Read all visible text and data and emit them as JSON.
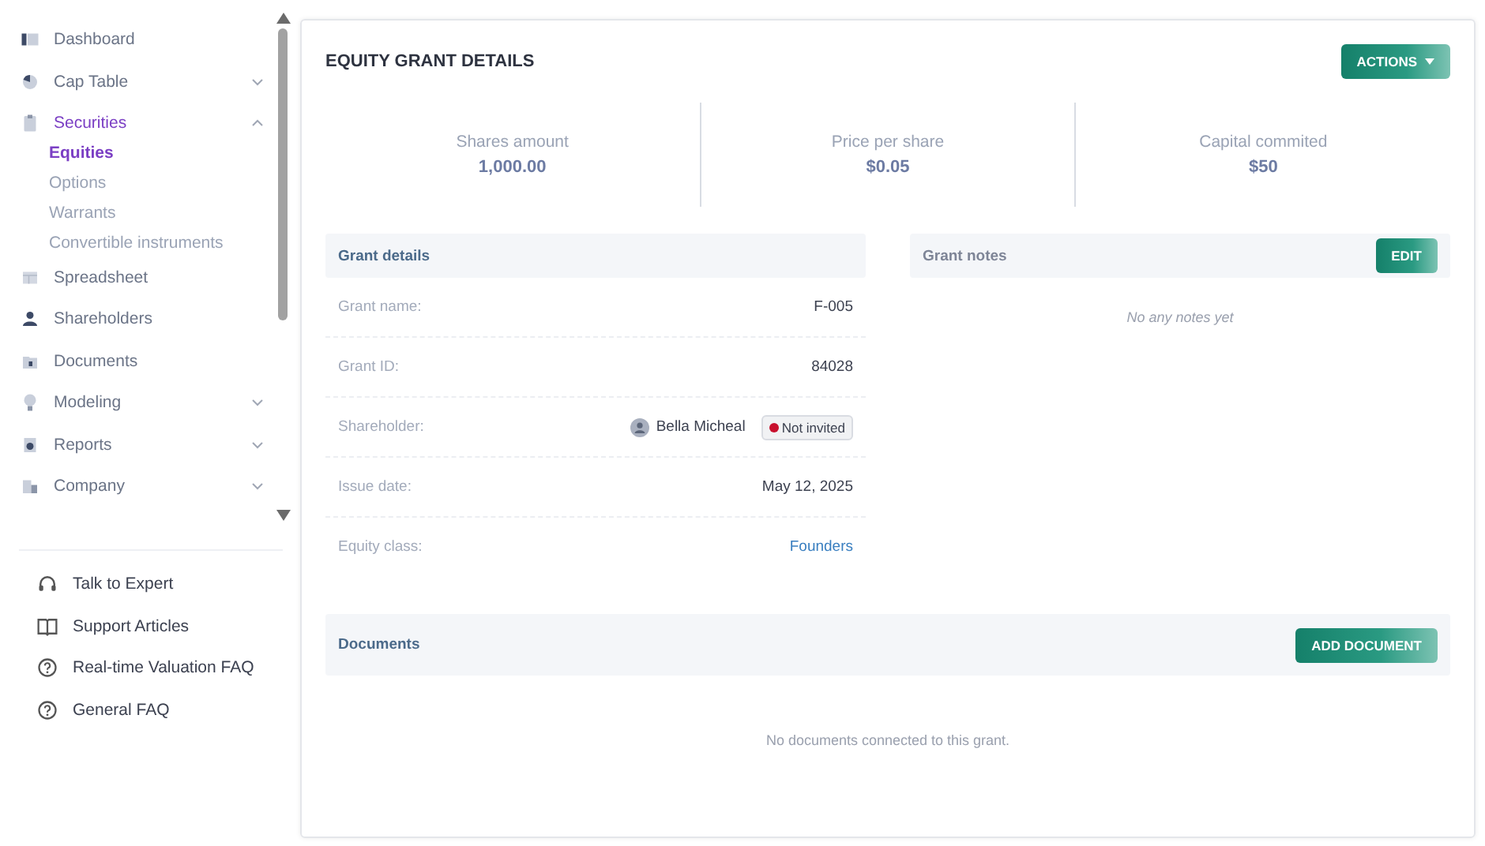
{
  "sidebar": {
    "items": [
      {
        "label": "Dashboard",
        "selected": false
      },
      {
        "label": "Cap Table",
        "selected": false,
        "expanded": false
      },
      {
        "label": "Securities",
        "selected": true,
        "expanded": true,
        "children": [
          {
            "label": "Equities",
            "selected": true
          },
          {
            "label": "Options",
            "selected": false
          },
          {
            "label": "Warrants",
            "selected": false
          },
          {
            "label": "Convertible instruments",
            "selected": false
          }
        ]
      },
      {
        "label": "Spreadsheet",
        "selected": false
      },
      {
        "label": "Shareholders",
        "selected": false
      },
      {
        "label": "Documents",
        "selected": false
      },
      {
        "label": "Modeling",
        "selected": false,
        "expanded": false
      },
      {
        "label": "Reports",
        "selected": false,
        "expanded": false
      },
      {
        "label": "Company",
        "selected": false,
        "expanded": false
      }
    ],
    "help_links": [
      "Talk to Expert",
      "Support Articles",
      "Real-time Valuation FAQ",
      "General FAQ"
    ]
  },
  "main": {
    "title": "EQUITY GRANT DETAILS",
    "actions_button": "ACTIONS",
    "stats": [
      {
        "label": "Shares amount",
        "value": "1,000.00"
      },
      {
        "label": "Price per share",
        "value": "$0.05"
      },
      {
        "label": "Capital commited",
        "value": "$50"
      }
    ],
    "grant_details": {
      "title": "Grant details",
      "rows": [
        {
          "kind": "text",
          "label": "Grant name:",
          "value": "F-005"
        },
        {
          "kind": "text",
          "label": "Grant ID:",
          "value": "84028"
        },
        {
          "kind": "person",
          "label": "Shareholder:",
          "value": "Bella Micheal",
          "status": {
            "text": "Not invited",
            "color": "#c8102e"
          }
        },
        {
          "kind": "text",
          "label": "Issue date:",
          "value": "May 12, 2025"
        },
        {
          "kind": "link",
          "label": "Equity class:",
          "value": "Founders"
        }
      ]
    },
    "grant_notes": {
      "title": "Grant notes",
      "button": "EDIT",
      "empty_text": "No any notes yet"
    },
    "documents": {
      "title": "Documents",
      "button": "ADD DOCUMENT",
      "empty_text": "No documents connected to this grant."
    }
  }
}
